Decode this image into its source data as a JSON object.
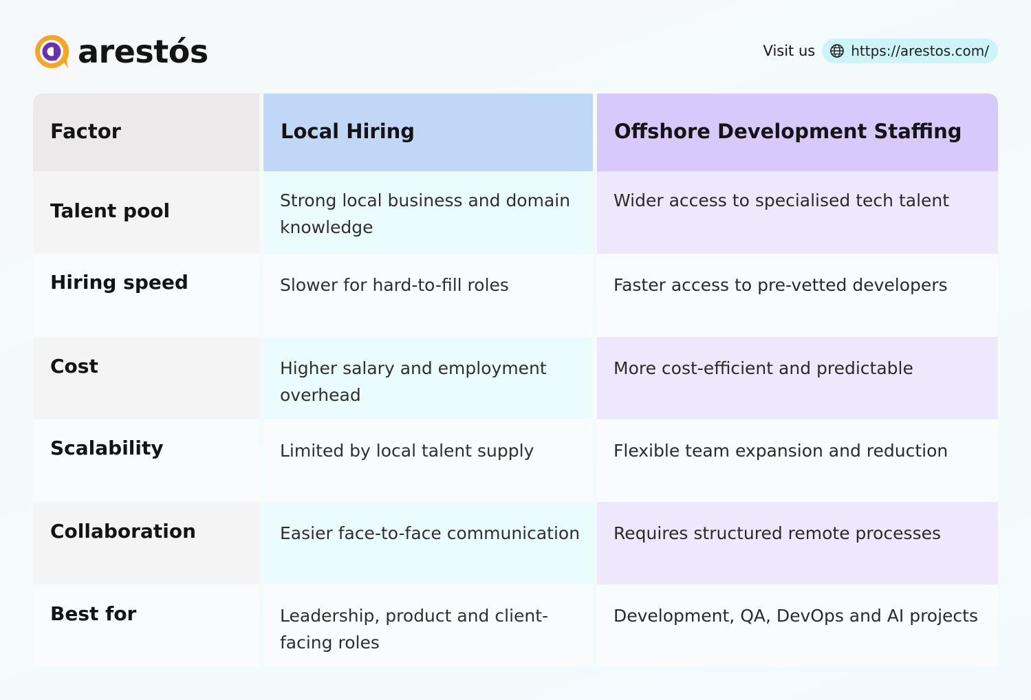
{
  "brand": {
    "name": "arestós",
    "logo_icon": "search-bubble-icon",
    "colors": {
      "orange": "#f5a623",
      "purple": "#6b2fb0"
    }
  },
  "visit": {
    "label": "Visit us",
    "url": "https://arestos.com/",
    "icon": "globe-icon"
  },
  "table": {
    "columns": [
      "Factor",
      "Local Hiring",
      "Offshore Development Staffing"
    ],
    "rows": [
      {
        "factor": "Talent pool",
        "local": "Strong local business and domain knowledge",
        "offshore": "Wider access to specialised tech talent"
      },
      {
        "factor": "Hiring speed",
        "local": "Slower for hard-to-fill roles",
        "offshore": "Faster access to pre-vetted developers"
      },
      {
        "factor": "Cost",
        "local": "Higher salary and employment overhead",
        "offshore": "More cost-efficient and predictable"
      },
      {
        "factor": "Scalability",
        "local": "Limited by local talent supply",
        "offshore": "Flexible team expansion and reduction"
      },
      {
        "factor": "Collaboration",
        "local": "Easier face-to-face communication",
        "offshore": "Requires structured remote processes"
      },
      {
        "factor": "Best for",
        "local": "Leadership, product and client-facing roles",
        "offshore": "Development, QA, DevOps and AI projects"
      }
    ],
    "colors": {
      "header_factor": "#ebe9ea",
      "header_local": "#c1d7f6",
      "header_offshore": "#d8c9fb",
      "local_tint": "#eafcfd",
      "offshore_tint": "#eee8fd",
      "url_pill": "#cdf4f8"
    }
  }
}
